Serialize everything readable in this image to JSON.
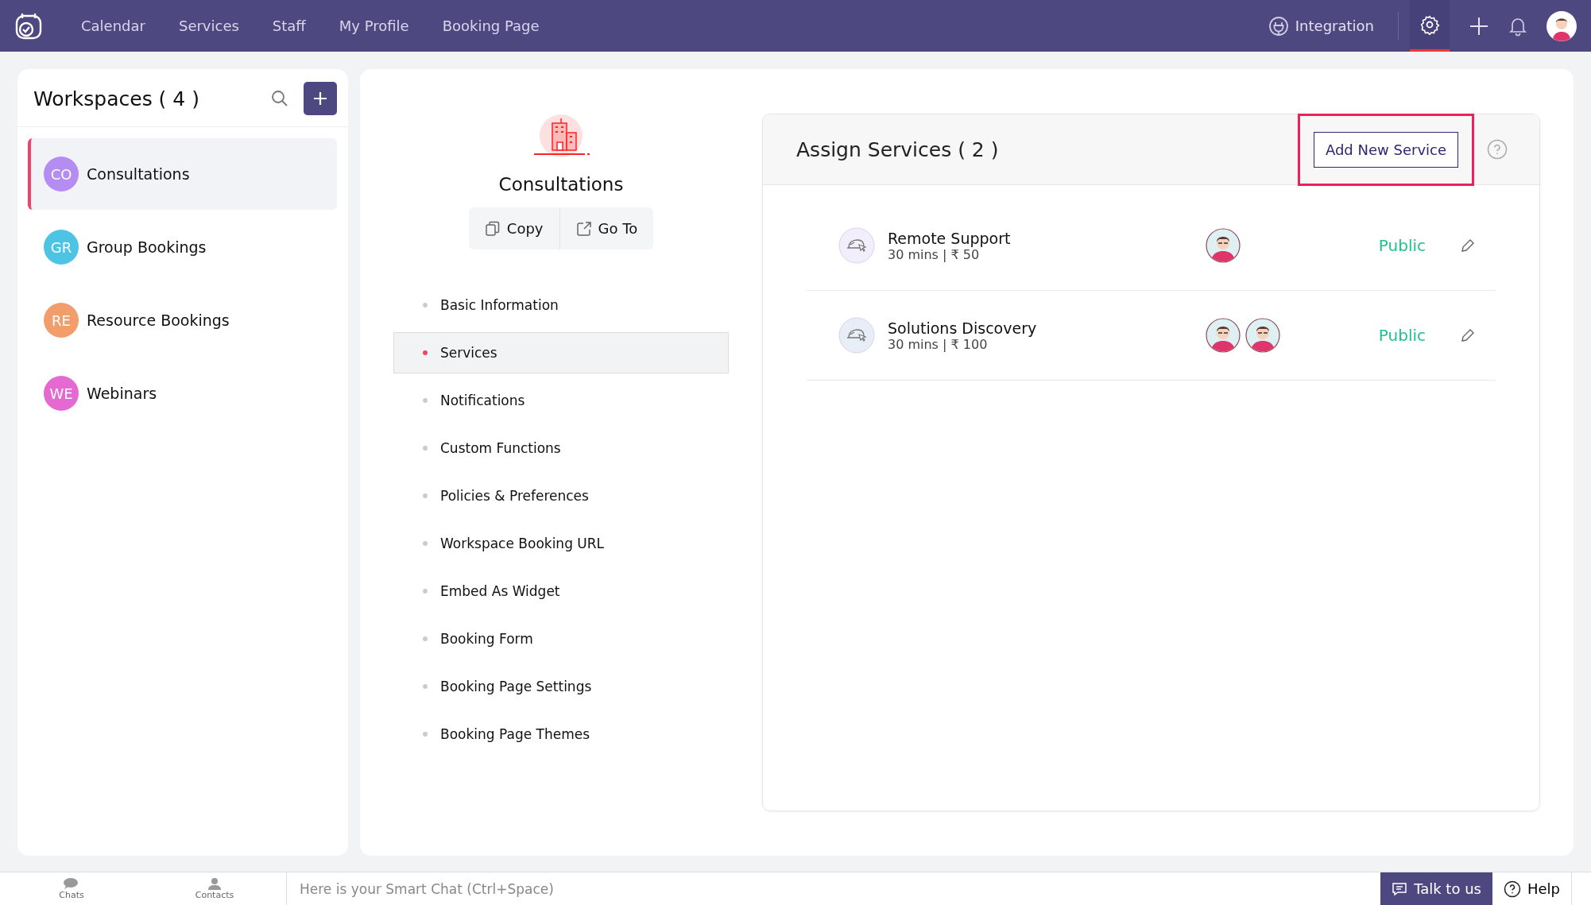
{
  "top_nav": {
    "items": [
      {
        "label": "Calendar",
        "selected": false
      },
      {
        "label": "Services",
        "selected": false
      },
      {
        "label": "Staff",
        "selected": false
      },
      {
        "label": "My Profile",
        "selected": false
      },
      {
        "label": "Booking Page",
        "selected": false
      }
    ],
    "integration": "Integration",
    "settings_selected": true
  },
  "workspaces": {
    "title": "Workspaces ( 4 )",
    "items": [
      {
        "initials": "CO",
        "name": "Consultations",
        "color": "#b48cf2",
        "selected": true
      },
      {
        "initials": "GR",
        "name": "Group Bookings",
        "color": "#4ec4e4",
        "selected": false
      },
      {
        "initials": "RE",
        "name": "Resource Bookings",
        "color": "#f29e6c",
        "selected": false
      },
      {
        "initials": "WE",
        "name": "Webinars",
        "color": "#e46ad2",
        "selected": false
      }
    ]
  },
  "workspace": {
    "name": "Consultations",
    "actions": [
      "Copy",
      "Go To"
    ],
    "menu": [
      {
        "label": "Basic Information",
        "selected": false
      },
      {
        "label": "Services",
        "selected": true
      },
      {
        "label": "Notifications",
        "selected": false
      },
      {
        "label": "Custom Functions",
        "selected": false
      },
      {
        "label": "Policies & Preferences",
        "selected": false
      },
      {
        "label": "Workspace Booking URL",
        "selected": false
      },
      {
        "label": "Embed As Widget",
        "selected": false
      },
      {
        "label": "Booking Form",
        "selected": false
      },
      {
        "label": "Booking Page Settings",
        "selected": false
      },
      {
        "label": "Booking Page Themes",
        "selected": false
      }
    ]
  },
  "assign_services": {
    "title": "Assign Services ( 2 )",
    "add_button": "Add New Service",
    "services": [
      {
        "name": "Remote Support",
        "details": "30 mins | ₹ 50",
        "color": "#f3eefc",
        "staff": [
          {
            "kind": "avatar"
          }
        ],
        "visibility": "Public"
      },
      {
        "name": "Solutions Discovery",
        "details": "30 mins | ₹ 100",
        "color": "#e8eef8",
        "staff": [
          {
            "kind": "avatar"
          },
          {
            "kind": "avatar"
          }
        ],
        "visibility": "Public"
      }
    ]
  },
  "bottom_bar": {
    "chats": "Chats",
    "contacts": "Contacts",
    "chat_placeholder": "Here is your Smart Chat (Ctrl+Space)",
    "talk_button": "Talk to us",
    "help": "Help"
  }
}
